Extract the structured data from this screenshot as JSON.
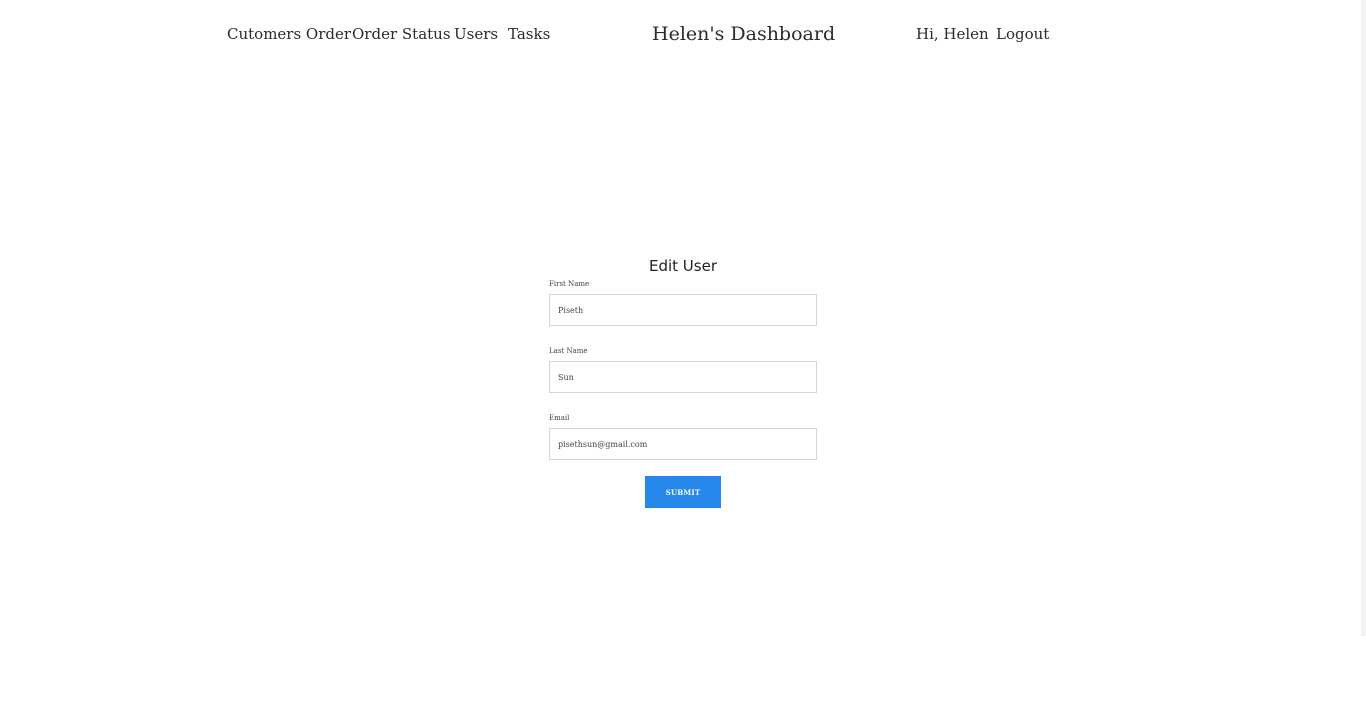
{
  "nav": {
    "left_links": [
      "Cutomers Order",
      "Order Status",
      "Users",
      "Tasks"
    ],
    "brand": "Helen's Dashboard",
    "greeting": "Hi, Helen",
    "logout": "Logout"
  },
  "form": {
    "title": "Edit User",
    "fields": [
      {
        "label": "First Name",
        "value": "Piseth"
      },
      {
        "label": "Last Name",
        "value": "Sun"
      },
      {
        "label": "Email",
        "value": "pisethsun@gmail.com"
      }
    ],
    "submit_label": "SUBMIT"
  },
  "colors": {
    "accent": "#2588ea",
    "input_border": "#d6d6d6"
  }
}
